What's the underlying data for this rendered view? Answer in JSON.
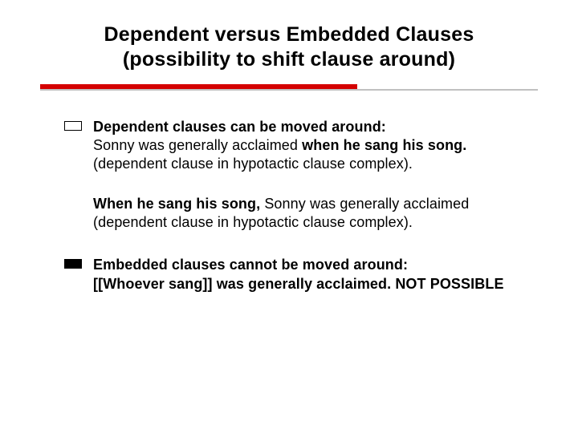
{
  "title_line1": "Dependent versus Embedded Clauses",
  "title_line2": "(possibility to shift clause around)",
  "bullets": {
    "b1": {
      "heading": "Dependent clauses can be moved around:",
      "ex1_pre": "Sonny was generally acclaimed ",
      "ex1_bold": "when he sang his song.",
      "ex1_post": " (dependent clause in hypotactic clause complex)."
    },
    "cont": {
      "bold": "When he sang his song, ",
      "rest": "Sonny was generally acclaimed (dependent clause in hypotactic clause complex)."
    },
    "b2": {
      "heading": "Embedded clauses cannot be moved around:",
      "ex_bold": "[[Whoever sang]]",
      "ex_rest": " was generally acclaimed. NOT POSSIBLE"
    }
  }
}
